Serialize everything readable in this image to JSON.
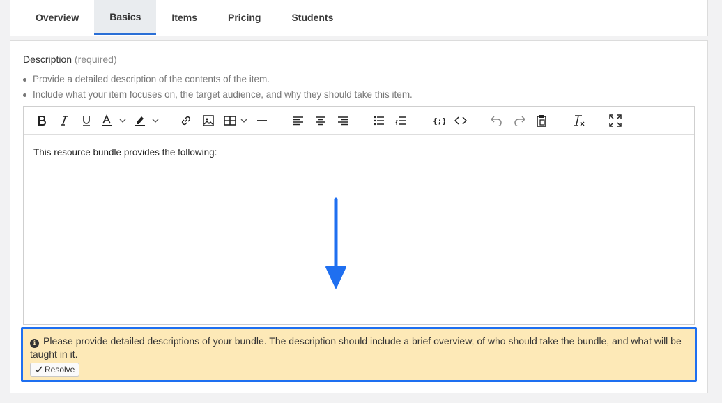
{
  "tabs": [
    {
      "label": "Overview",
      "active": false
    },
    {
      "label": "Basics",
      "active": true
    },
    {
      "label": "Items",
      "active": false
    },
    {
      "label": "Pricing",
      "active": false
    },
    {
      "label": "Students",
      "active": false
    }
  ],
  "field": {
    "label": "Description",
    "required": "(required)",
    "hints": [
      "Provide a detailed description of the contents of the item.",
      "Include what your item focuses on, the target audience, and why they should take this item."
    ]
  },
  "editor": {
    "toolbar": [
      "bold-icon",
      "italic-icon",
      "underline-icon",
      "text-color-icon",
      "highlight-color-icon",
      "link-icon",
      "image-icon",
      "table-icon",
      "horizontal-rule-icon",
      "align-left-icon",
      "align-center-icon",
      "align-right-icon",
      "bullet-list-icon",
      "numbered-list-icon",
      "code-block-icon",
      "source-code-icon",
      "undo-icon",
      "redo-icon",
      "paste-icon",
      "clear-format-icon",
      "fullscreen-icon"
    ],
    "content": "This resource bundle provides the following:"
  },
  "alert": {
    "message": "Please provide detailed descriptions of your bundle. The description should include a brief overview, of who should take the bundle, and what will be taught in it.",
    "resolve_label": "Resolve"
  },
  "colors": {
    "accent": "#2a6fd6",
    "alert_bg": "#fde9b7",
    "alert_border": "#1e6ff0",
    "arrow": "#1f6ff0"
  }
}
